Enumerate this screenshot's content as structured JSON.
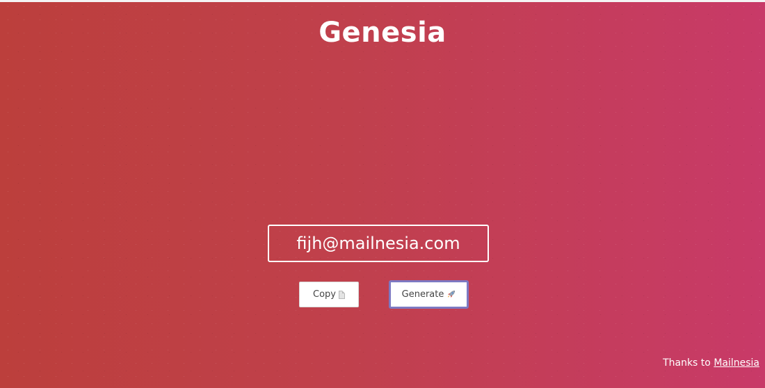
{
  "app": {
    "title": "Genesia"
  },
  "email": {
    "value": "fijh@mailnesia.com"
  },
  "actions": {
    "copy_label": "Copy",
    "copy_icon": "document-icon",
    "generate_label": "Generate",
    "generate_icon": "rocket-icon"
  },
  "footer": {
    "prefix": "Thanks to",
    "link_label": "Mailnesia"
  },
  "colors": {
    "gradient_left": "#bc3f3c",
    "gradient_right": "#c83a68",
    "focus_ring": "#7d79c2"
  }
}
